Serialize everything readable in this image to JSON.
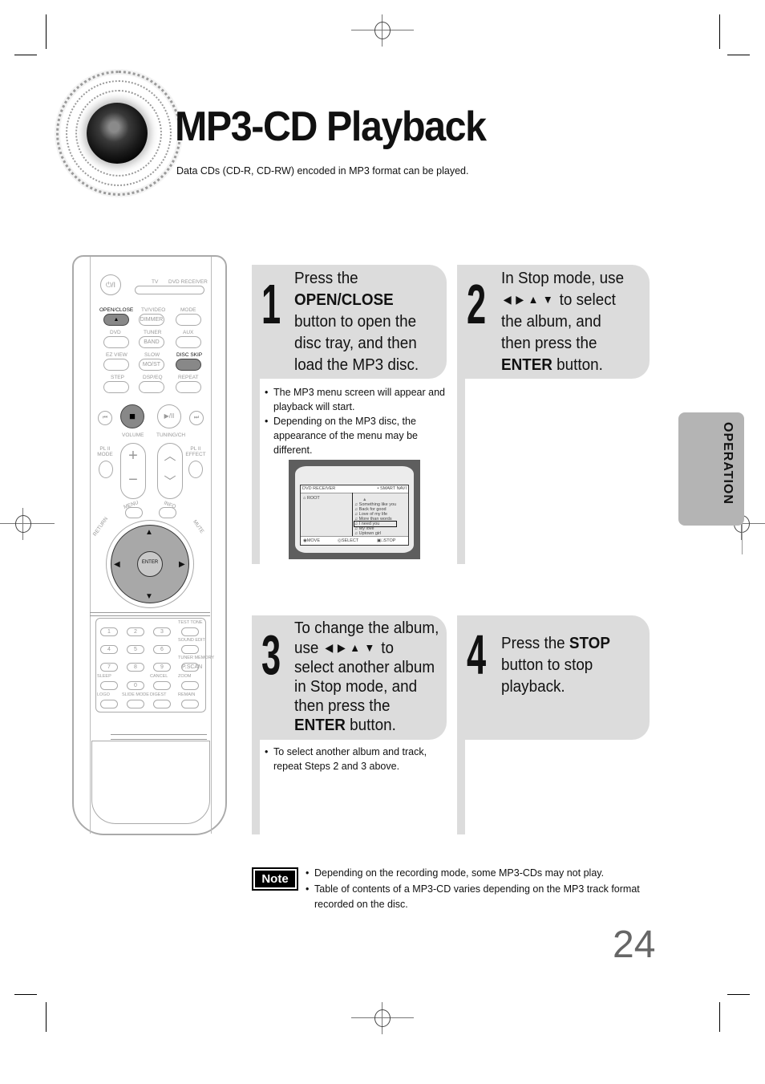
{
  "header": {
    "title": "MP3-CD Playback",
    "subtitle": "Data CDs (CD-R, CD-RW) encoded in MP3 format can be played."
  },
  "remote": {
    "top_buttons": [
      "TV",
      "DVD RECEIVER"
    ],
    "power_label": "⏻/I",
    "rows": [
      [
        "OPEN/CLOSE",
        "TV/VIDEO",
        "MODE"
      ],
      [
        "DVD",
        "TUNER",
        "AUX"
      ],
      [
        "EZ VIEW",
        "SLOW",
        "DISC SKIP"
      ],
      [
        "STEP",
        "DSP/EQ",
        "REPEAT"
      ]
    ],
    "sub_labels": {
      "dimmer": "DIMMER",
      "band": "BAND",
      "mo_st": "MO/ST"
    },
    "transport": [
      "⏮",
      "■",
      "▶/II",
      "⏭"
    ],
    "volume_label": "VOLUME",
    "tuning_label": "TUNING/CH",
    "pl2_mode": "PL II MODE",
    "pl2_effect": "PL II EFFECT",
    "menu_label": "MENU",
    "info_label": "INFO",
    "return_label": "RETURN",
    "mute_label": "MUTE",
    "enter_label": "ENTER",
    "keypad": {
      "digits": [
        "1",
        "2",
        "3",
        "4",
        "5",
        "6",
        "7",
        "8",
        "9",
        "0"
      ],
      "labels": [
        "TEST TONE",
        "SOUND EDIT",
        "TUNER MEMORY",
        "P.SCAN",
        "SLEEP",
        "CANCEL",
        "ZOOM",
        "LOGO",
        "SLIDE MODE",
        "DIGEST",
        "REMAIN"
      ]
    }
  },
  "steps": [
    {
      "number": "1",
      "lines": [
        "Press the",
        "<b>OPEN/CLOSE</b>",
        "button to open the",
        "disc tray, and then",
        "load the MP3 disc."
      ],
      "bullets": [
        "The MP3 menu screen will appear and playback will start.",
        "Depending on the MP3 disc, the appearance of the menu may be different."
      ]
    },
    {
      "number": "2",
      "lines": [
        "In Stop mode, use",
        "ARROWS to select",
        "the album, and",
        "then press the",
        "<b>ENTER</b> button."
      ]
    },
    {
      "number": "3",
      "lines": [
        "To change the album,",
        "use ARROWS to",
        "select another album",
        "in Stop mode, and",
        "then press the",
        "<b>ENTER</b> button."
      ],
      "bullets": [
        "To select another album and track, repeat Steps 2 and 3 above."
      ]
    },
    {
      "number": "4",
      "lines": [
        "Press the <b>STOP</b>",
        "button to stop",
        "playback."
      ]
    }
  ],
  "arrows": [
    "◀",
    "▶",
    "▲",
    "▼"
  ],
  "screen": {
    "header_left": "DVD RECEIVER",
    "header_right": "• SMART NAVI",
    "folder": "ROOT",
    "tracks": [
      "Something like you",
      "Back for good",
      "Love of my life",
      "More than words",
      "I need you",
      "My love",
      "Uptown girl"
    ],
    "selected_track": "I need you",
    "footer": [
      "MOVE",
      "SELECT",
      "STOP"
    ]
  },
  "side_tab": "OPERATION",
  "note": {
    "label": "Note",
    "items": [
      "Depending on the recording mode, some MP3-CDs may not play.",
      "Table of contents of a MP3-CD varies depending on the MP3 track format recorded on the disc."
    ]
  },
  "page_number": "24"
}
